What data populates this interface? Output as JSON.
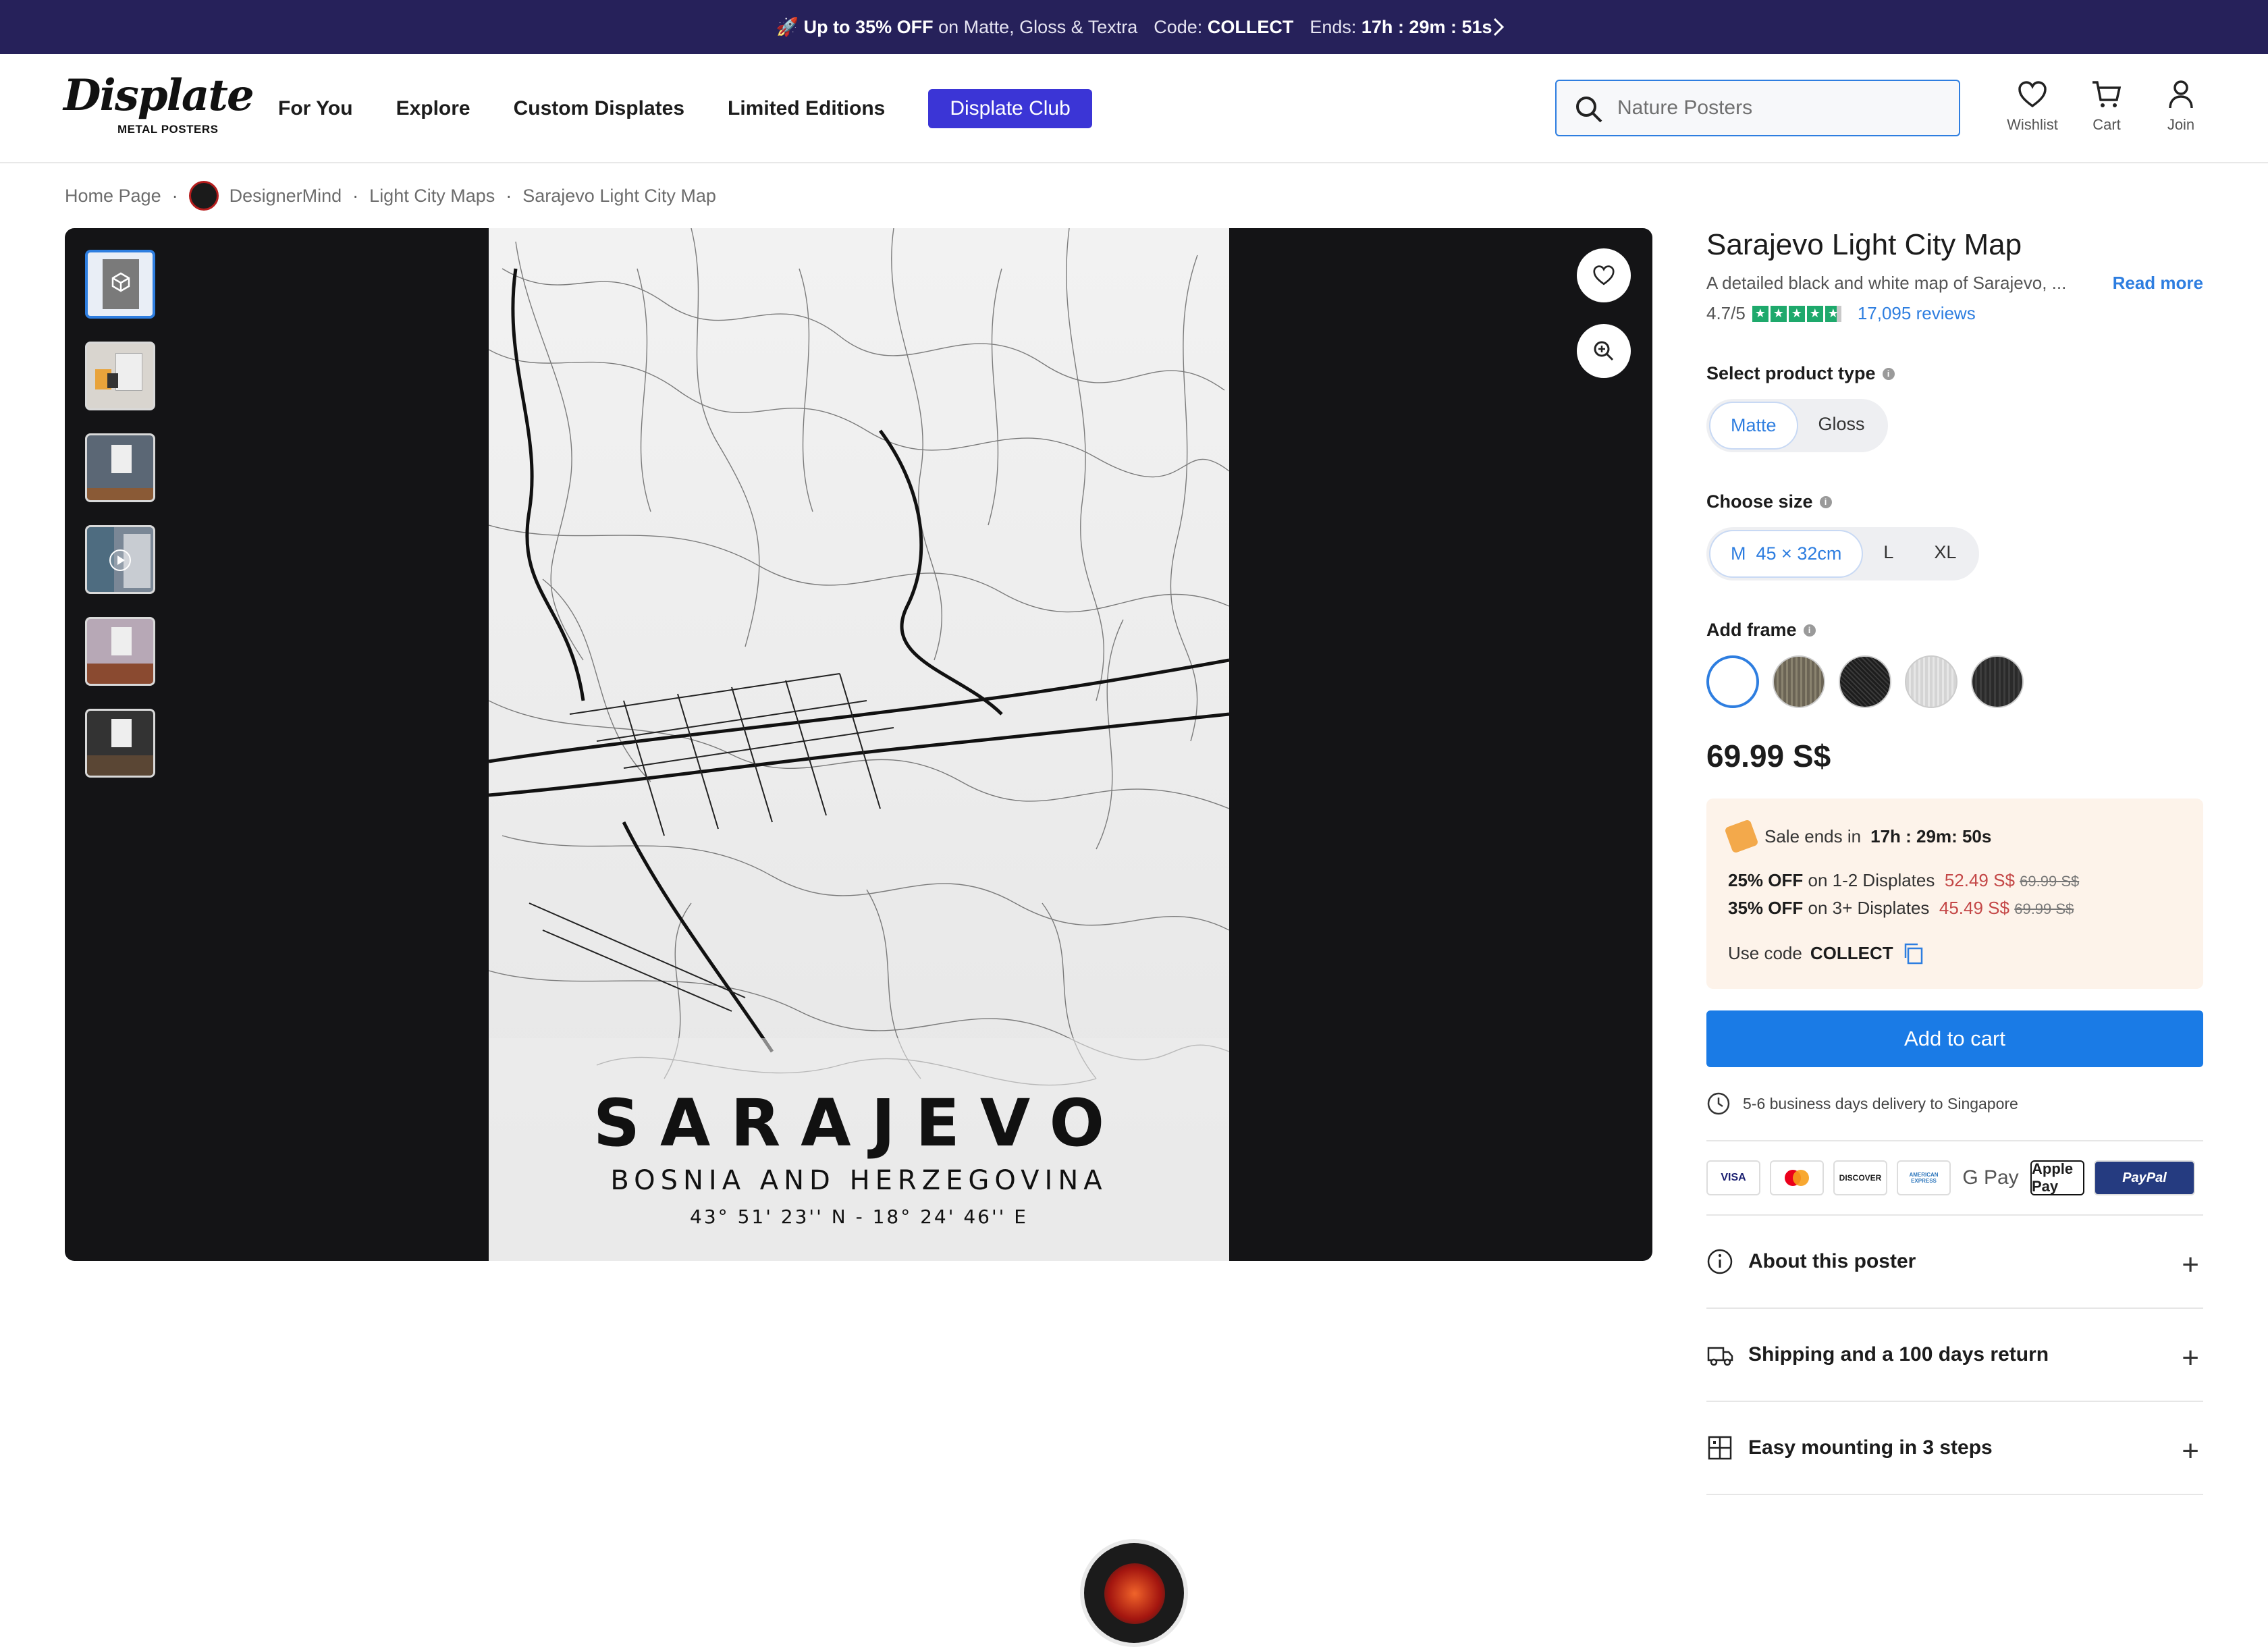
{
  "banner": {
    "rocket": "🚀",
    "promo_bold": "Up to 35% OFF",
    "promo_rest": "on Matte, Gloss & Textra",
    "code_label": "Code:",
    "code": "COLLECT",
    "ends_label": "Ends:",
    "ends_h": "17h",
    "ends_m": ": 29m",
    "ends_s": ": 51s"
  },
  "header": {
    "logo_text": "Displate",
    "logo_sub": "METAL POSTERS",
    "nav": [
      "For You",
      "Explore",
      "Custom Displates",
      "Limited Editions"
    ],
    "club": "Displate Club",
    "search_placeholder": "Nature Posters",
    "wishlist": "Wishlist",
    "cart": "Cart",
    "join": "Join"
  },
  "breadcrumb": [
    "Home Page",
    "DesignerMind",
    "Light City Maps",
    "Sarajevo Light City Map"
  ],
  "poster": {
    "city": "SARAJEVO",
    "country": "BOSNIA AND HERZEGOVINA",
    "coords": "43° 51' 23'' N - 18° 24' 46'' E"
  },
  "product": {
    "title": "Sarajevo Light City Map",
    "description": "A detailed black and white map of Sarajevo, ...",
    "read_more": "Read more",
    "rating": "4.7/5",
    "reviews": "17,095 reviews",
    "type_label": "Select product type",
    "types": [
      "Matte",
      "Gloss"
    ],
    "size_label": "Choose size",
    "size_selected_letter": "M",
    "size_selected_dim": "45 × 32cm",
    "sizes_other": [
      "L",
      "XL"
    ],
    "frame_label": "Add frame",
    "frame_colors": [
      "#ffffff",
      "#6b6455",
      "#1d1d1d",
      "#d4d4d4",
      "#2a2a2a"
    ],
    "price": "69.99 S$"
  },
  "sale": {
    "ends_label": "Sale ends in",
    "h": "17h",
    "m": ": 29m",
    "s": ": 50s",
    "tier1_bold": "25% OFF",
    "tier1_rest": "on 1-2 Displates",
    "tier1_price": "52.49 S$",
    "tier1_old": "69.99 S$",
    "tier2_bold": "35% OFF",
    "tier2_rest": "on 3+ Displates",
    "tier2_price": "45.49 S$",
    "tier2_old": "69.99 S$",
    "code_label": "Use code",
    "code": "COLLECT"
  },
  "add_to_cart": "Add to cart",
  "delivery": "5-6 business days delivery to Singapore",
  "payments": [
    "VISA",
    "Mastercard",
    "DISCOVER",
    "AMERICAN EXPRESS",
    "G Pay",
    "Apple Pay",
    "PayPal"
  ],
  "accordion": [
    "About this poster",
    "Shipping and a 100 days return",
    "Easy mounting in 3 steps"
  ],
  "colors": {
    "banner_bg": "#26215a",
    "club_bg": "#3b35d6",
    "accent": "#1a7be6",
    "sale_bg": "#fdf3ea",
    "sale_red": "#c44747",
    "rating_green": "#1ea96c"
  }
}
